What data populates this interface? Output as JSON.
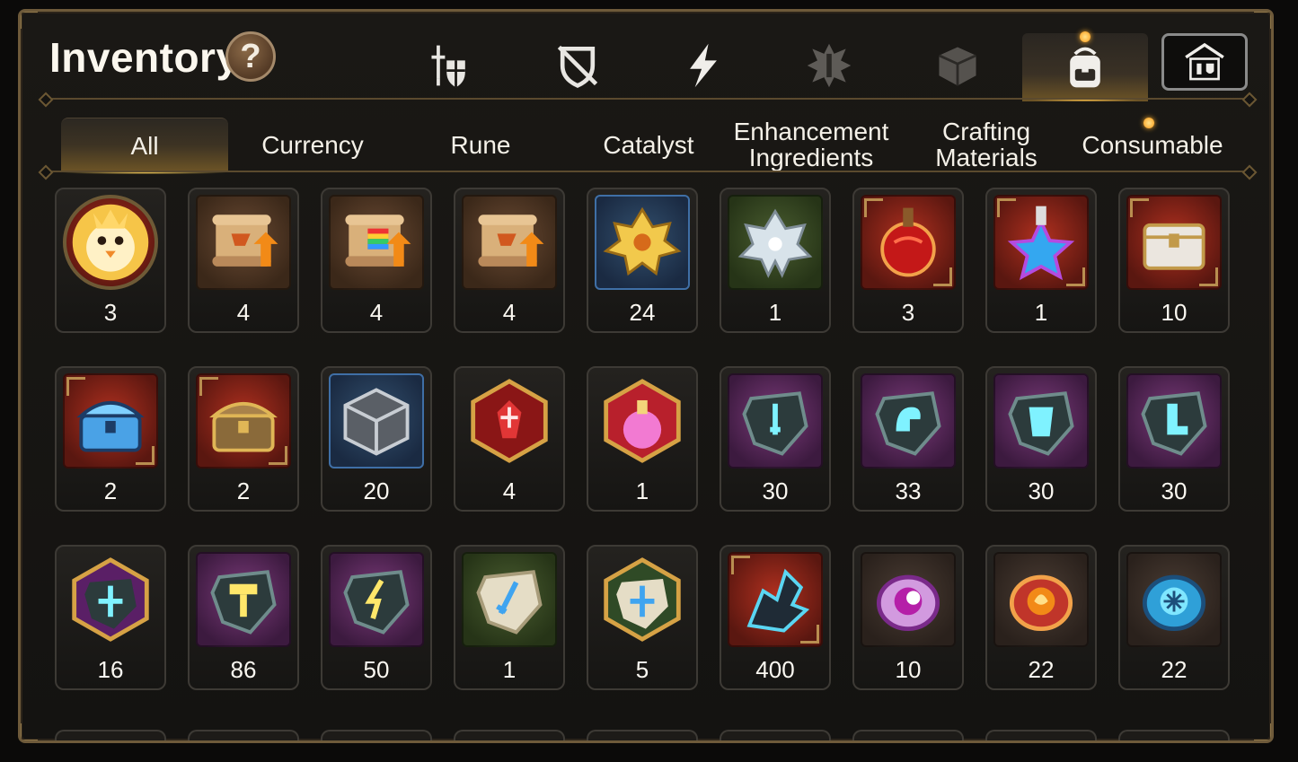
{
  "header": {
    "title": "Inventory",
    "help_label": "?"
  },
  "categories": [
    {
      "icon": "sword-shield-icon"
    },
    {
      "icon": "shield-slash-icon"
    },
    {
      "icon": "lightning-icon"
    },
    {
      "icon": "spiked-emblem-icon"
    },
    {
      "icon": "dice-cube-icon"
    },
    {
      "icon": "backpack-icon",
      "active": true
    },
    {
      "icon": "helmet-banner-icon"
    }
  ],
  "tabs": [
    {
      "label": "All",
      "active": true
    },
    {
      "label": "Currency"
    },
    {
      "label": "Rune"
    },
    {
      "label": "Catalyst"
    },
    {
      "label": "Enhancement Ingredients"
    },
    {
      "label": "Crafting Materials"
    },
    {
      "label": "Consumable"
    }
  ],
  "items": [
    {
      "icon": "mascot-bird-coin-icon",
      "qty": "3"
    },
    {
      "icon": "scroll-upgrade-orange-icon",
      "qty": "4"
    },
    {
      "icon": "scroll-upgrade-rainbow-icon",
      "qty": "4"
    },
    {
      "icon": "scroll-upgrade-basic-icon",
      "qty": "4"
    },
    {
      "icon": "gold-crystal-cluster-icon",
      "qty": "24"
    },
    {
      "icon": "silver-crystal-flower-icon",
      "qty": "1"
    },
    {
      "icon": "red-potion-flask-icon",
      "qty": "3"
    },
    {
      "icon": "star-potion-icon",
      "qty": "1"
    },
    {
      "icon": "ornate-chest-white-icon",
      "qty": "10"
    },
    {
      "icon": "blue-treasure-chest-icon",
      "qty": "2"
    },
    {
      "icon": "golden-treasure-chest-icon",
      "qty": "2"
    },
    {
      "icon": "silver-cube-box-icon",
      "qty": "20"
    },
    {
      "icon": "red-gem-emblem-icon",
      "qty": "4"
    },
    {
      "icon": "pink-potion-emblem-icon",
      "qty": "1"
    },
    {
      "icon": "sword-rune-stone-icon",
      "qty": "30"
    },
    {
      "icon": "helmet-rune-stone-icon",
      "qty": "33"
    },
    {
      "icon": "armor-rune-stone-icon",
      "qty": "30"
    },
    {
      "icon": "boot-rune-stone-icon",
      "qty": "30"
    },
    {
      "icon": "star-rune-emblem-icon",
      "qty": "16"
    },
    {
      "icon": "hammer-rune-stone-icon",
      "qty": "86"
    },
    {
      "icon": "bolt-rune-stone-icon",
      "qty": "50"
    },
    {
      "icon": "sword-white-stone-icon",
      "qty": "1"
    },
    {
      "icon": "star-white-stone-emblem-icon",
      "qty": "5"
    },
    {
      "icon": "dark-crystal-shard-icon",
      "qty": "400"
    },
    {
      "icon": "purple-orb-disc-icon",
      "qty": "10"
    },
    {
      "icon": "fire-orb-disc-icon",
      "qty": "22"
    },
    {
      "icon": "ice-orb-disc-icon",
      "qty": "22"
    }
  ]
}
